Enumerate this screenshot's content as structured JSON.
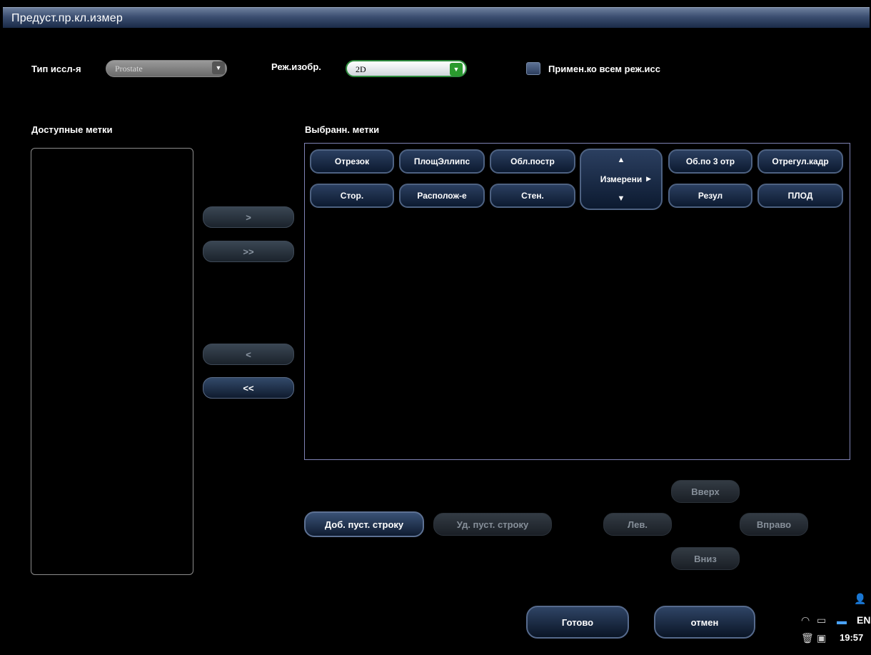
{
  "title": "Предуст.пр.кл.измер",
  "exam_type": {
    "label": "Тип иссл-я",
    "value": "Prostate"
  },
  "image_mode": {
    "label": "Реж.изобр.",
    "value": "2D"
  },
  "apply_all": {
    "label": "Примен.ко всем реж.исс"
  },
  "available": {
    "label": "Доступные метки"
  },
  "selected": {
    "label": "Выбранн. метки",
    "row1": [
      "Отрезок",
      "ПлощЭллипс",
      "Обл.постр",
      "Об.по 3 отр",
      "Отрегул.кадр"
    ],
    "row2": [
      "Стор.",
      "Располож-е",
      "Стен.",
      "Резул",
      "ПЛОД"
    ],
    "spinner_label": "Измерени"
  },
  "move": {
    "add_one": ">",
    "add_all": ">>",
    "remove_one": "<",
    "remove_all": "<<"
  },
  "rows": {
    "add": "Доб. пуст. строку",
    "delete": "Уд. пуст. строку"
  },
  "nav": {
    "up": "Вверх",
    "left": "Лев.",
    "right": "Вправо",
    "down": "Вниз"
  },
  "footer": {
    "done": "Готово",
    "cancel": "отмен"
  },
  "tray": {
    "lang": "EN",
    "time": "19:57"
  }
}
